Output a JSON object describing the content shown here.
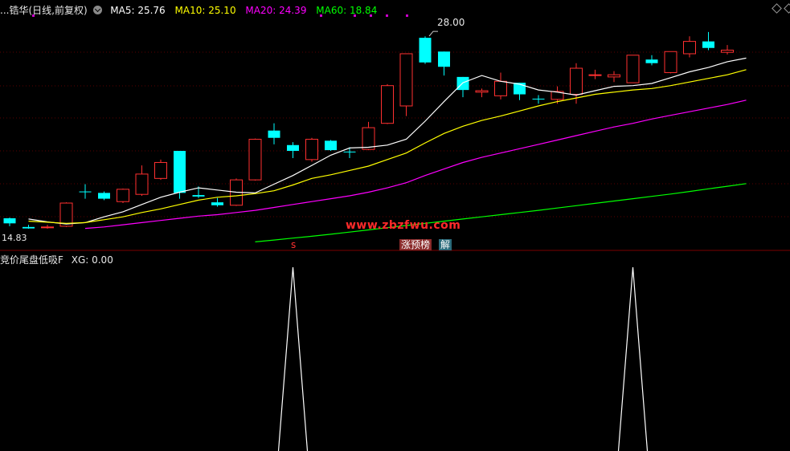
{
  "header": {
    "title": "...锆华(日线,前复权)",
    "ma5": "MA5: 25.76",
    "ma10": "MA10: 25.10",
    "ma20": "MA20: 24.39",
    "ma60": "MA60: 18.84"
  },
  "subpanel": {
    "title": "竞价尾盘低吸F",
    "xg": "XG: 0.00"
  },
  "labels": {
    "low": "14.83",
    "high": "28.00",
    "watermark": "www.zbzfwu.com",
    "tag_s": "s",
    "tag_zhang": "涨预榜",
    "tag_jie": "解"
  },
  "colors": {
    "background": "#000000",
    "up": "#ff3030",
    "down": "#00ffff",
    "ma5": "#ffffff",
    "ma10": "#ffff00",
    "ma20": "#ff00ff",
    "ma60": "#00ff00",
    "marker": "#cc00cc"
  },
  "chart_data": [
    {
      "type": "candlestick",
      "title": "锆华(日线,前复权)",
      "price_range": [
        14.0,
        29.5
      ],
      "candles": [
        {
          "o": 15.55,
          "c": 15.2,
          "h": 15.6,
          "l": 15.0
        },
        {
          "o": 14.95,
          "c": 14.85,
          "h": 15.1,
          "l": 14.83
        },
        {
          "o": 14.9,
          "c": 14.95,
          "h": 15.1,
          "l": 14.83
        },
        {
          "o": 15.0,
          "c": 16.6,
          "h": 16.65,
          "l": 14.95
        },
        {
          "o": 17.4,
          "c": 17.35,
          "h": 17.9,
          "l": 16.9
        },
        {
          "o": 17.3,
          "c": 16.9,
          "h": 17.4,
          "l": 16.8
        },
        {
          "o": 16.7,
          "c": 17.55,
          "h": 17.6,
          "l": 16.6
        },
        {
          "o": 17.2,
          "c": 18.6,
          "h": 19.2,
          "l": 17.1
        },
        {
          "o": 18.3,
          "c": 19.4,
          "h": 19.6,
          "l": 18.2
        },
        {
          "o": 20.2,
          "c": 17.3,
          "h": 20.2,
          "l": 16.9
        },
        {
          "o": 17.15,
          "c": 17.05,
          "h": 17.75,
          "l": 16.95
        },
        {
          "o": 16.65,
          "c": 16.45,
          "h": 16.95,
          "l": 16.35
        },
        {
          "o": 16.45,
          "c": 18.2,
          "h": 18.3,
          "l": 16.4
        },
        {
          "o": 18.2,
          "c": 21.0,
          "h": 21.05,
          "l": 18.15
        },
        {
          "o": 21.6,
          "c": 21.1,
          "h": 22.1,
          "l": 20.65
        },
        {
          "o": 20.6,
          "c": 20.2,
          "h": 20.8,
          "l": 19.7
        },
        {
          "o": 19.6,
          "c": 21.0,
          "h": 21.1,
          "l": 19.45
        },
        {
          "o": 20.9,
          "c": 20.25,
          "h": 20.95,
          "l": 20.2
        },
        {
          "o": 20.15,
          "c": 20.1,
          "h": 20.45,
          "l": 19.7
        },
        {
          "o": 20.3,
          "c": 21.8,
          "h": 22.2,
          "l": 20.25
        },
        {
          "o": 22.1,
          "c": 24.7,
          "h": 24.8,
          "l": 22.05
        },
        {
          "o": 23.3,
          "c": 26.9,
          "h": 26.9,
          "l": 22.6
        },
        {
          "o": 28.0,
          "c": 26.3,
          "h": 28.1,
          "l": 26.2
        },
        {
          "o": 27.05,
          "c": 26.0,
          "h": 27.05,
          "l": 25.4
        },
        {
          "o": 25.3,
          "c": 24.4,
          "h": 25.3,
          "l": 23.9
        },
        {
          "o": 24.25,
          "c": 24.35,
          "h": 24.5,
          "l": 23.9
        },
        {
          "o": 24.0,
          "c": 25.0,
          "h": 25.6,
          "l": 23.75
        },
        {
          "o": 24.9,
          "c": 24.1,
          "h": 24.9,
          "l": 23.7
        },
        {
          "o": 23.8,
          "c": 23.75,
          "h": 24.05,
          "l": 23.45
        },
        {
          "o": 23.75,
          "c": 24.3,
          "h": 24.65,
          "l": 23.45
        },
        {
          "o": 24.1,
          "c": 25.9,
          "h": 26.25,
          "l": 23.45
        },
        {
          "o": 25.45,
          "c": 25.45,
          "h": 25.8,
          "l": 25.15
        },
        {
          "o": 25.3,
          "c": 25.45,
          "h": 25.7,
          "l": 24.95
        },
        {
          "o": 24.9,
          "c": 26.8,
          "h": 26.8,
          "l": 24.95
        },
        {
          "o": 26.5,
          "c": 26.25,
          "h": 26.8,
          "l": 26.1
        },
        {
          "o": 25.6,
          "c": 27.05,
          "h": 27.05,
          "l": 25.55
        },
        {
          "o": 26.9,
          "c": 27.75,
          "h": 28.1,
          "l": 26.65
        },
        {
          "o": 27.75,
          "c": 27.3,
          "h": 28.4,
          "l": 27.15
        },
        {
          "o": 27.0,
          "c": 27.15,
          "h": 27.5,
          "l": 26.85
        }
      ],
      "series": [
        {
          "name": "MA5",
          "values": [
            15.5,
            15.3,
            15.15,
            15.25,
            15.65,
            16.0,
            16.5,
            17.0,
            17.35,
            17.65,
            17.5,
            17.35,
            17.3,
            17.9,
            18.5,
            19.2,
            19.9,
            20.4,
            20.45,
            20.6,
            21.0,
            22.25,
            23.6,
            24.9,
            25.4,
            25.0,
            24.8,
            24.4,
            24.25,
            24.05,
            24.35,
            24.65,
            24.7,
            24.85,
            25.25,
            25.65,
            25.95,
            26.35,
            26.6
          ]
        },
        {
          "name": "MA10",
          "values": [
            15.35,
            15.28,
            15.2,
            15.25,
            15.45,
            15.65,
            15.95,
            16.2,
            16.5,
            16.8,
            17.0,
            17.1,
            17.25,
            17.45,
            17.85,
            18.3,
            18.55,
            18.85,
            19.15,
            19.6,
            20.05,
            20.75,
            21.4,
            21.9,
            22.3,
            22.6,
            22.95,
            23.3,
            23.6,
            23.85,
            24.1,
            24.25,
            24.4,
            24.5,
            24.7,
            24.95,
            25.2,
            25.45,
            25.8
          ]
        },
        {
          "name": "MA20",
          "values": [
            null,
            null,
            null,
            14.85,
            14.95,
            15.1,
            15.25,
            15.4,
            15.55,
            15.7,
            15.8,
            15.95,
            16.1,
            16.3,
            16.5,
            16.7,
            16.9,
            17.1,
            17.35,
            17.65,
            18.0,
            18.5,
            18.95,
            19.4,
            19.75,
            20.05,
            20.35,
            20.65,
            20.95,
            21.25,
            21.55,
            21.85,
            22.1,
            22.4,
            22.65,
            22.9,
            23.15,
            23.4,
            23.7
          ]
        },
        {
          "name": "MA60",
          "values": [
            null,
            null,
            null,
            null,
            null,
            null,
            null,
            null,
            null,
            null,
            null,
            null,
            13.92,
            14.05,
            14.18,
            14.31,
            14.45,
            14.6,
            14.75,
            14.9,
            15.05,
            15.2,
            15.35,
            15.5,
            15.65,
            15.8,
            15.95,
            16.1,
            16.26,
            16.42,
            16.58,
            16.74,
            16.9,
            17.06,
            17.22,
            17.4,
            17.58,
            17.76,
            17.94
          ]
        }
      ]
    },
    {
      "type": "line",
      "name": "XG",
      "signal_bars": [
        15,
        33
      ],
      "range": [
        0,
        1
      ]
    }
  ]
}
